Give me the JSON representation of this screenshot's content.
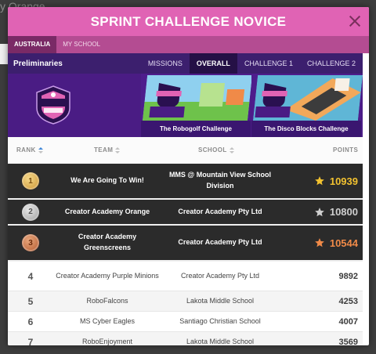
{
  "backdrop": {
    "title": "y Orange"
  },
  "modal": {
    "title": "SPRINT CHALLENGE NOVICE",
    "region_tabs": [
      "AUSTRALIA",
      "MY SCHOOL"
    ],
    "subnav": {
      "title": "Preliminaries",
      "links": [
        "MISSIONS",
        "OVERALL",
        "CHALLENGE 1",
        "CHALLENGE 2"
      ]
    },
    "banners": [
      {
        "caption": "The Robogolf Challenge"
      },
      {
        "caption": "The Disco Blocks Challenge"
      }
    ],
    "table": {
      "headers": {
        "rank": "RANK",
        "team": "TEAM",
        "school": "SCHOOL",
        "points": "POINTS"
      },
      "rows": [
        {
          "rank": "1",
          "team": "We Are Going To Win!",
          "school": "MMS @ Mountain View School Division",
          "points": "10939"
        },
        {
          "rank": "2",
          "team": "Creator Academy Orange",
          "school": "Creator Academy Pty Ltd",
          "points": "10800"
        },
        {
          "rank": "3",
          "team": "Creator Academy Greenscreens",
          "school": "Creator Academy Pty Ltd",
          "points": "10544"
        },
        {
          "rank": "4",
          "team": "Creator Academy Purple Minions",
          "school": "Creator Academy Pty Ltd",
          "points": "9892"
        },
        {
          "rank": "5",
          "team": "RoboFalcons",
          "school": "Lakota Middle School",
          "points": "4253"
        },
        {
          "rank": "6",
          "team": "MS Cyber Eagles",
          "school": "Santiago Christian School",
          "points": "4007"
        },
        {
          "rank": "7",
          "team": "RoboEnjoyment",
          "school": "Lakota Middle School",
          "points": "3569"
        }
      ]
    }
  },
  "colors": {
    "header_pink": "#e063b4",
    "tabs_magenta": "#b44c92",
    "subnav_purple": "#3c1f6e",
    "gold": "#f2c230",
    "silver": "#cfcfcf",
    "bronze": "#f08a48"
  },
  "icons": {
    "close": "close-icon",
    "sort": "sort-icon",
    "star": "star-icon",
    "medal": "medal-icon"
  }
}
